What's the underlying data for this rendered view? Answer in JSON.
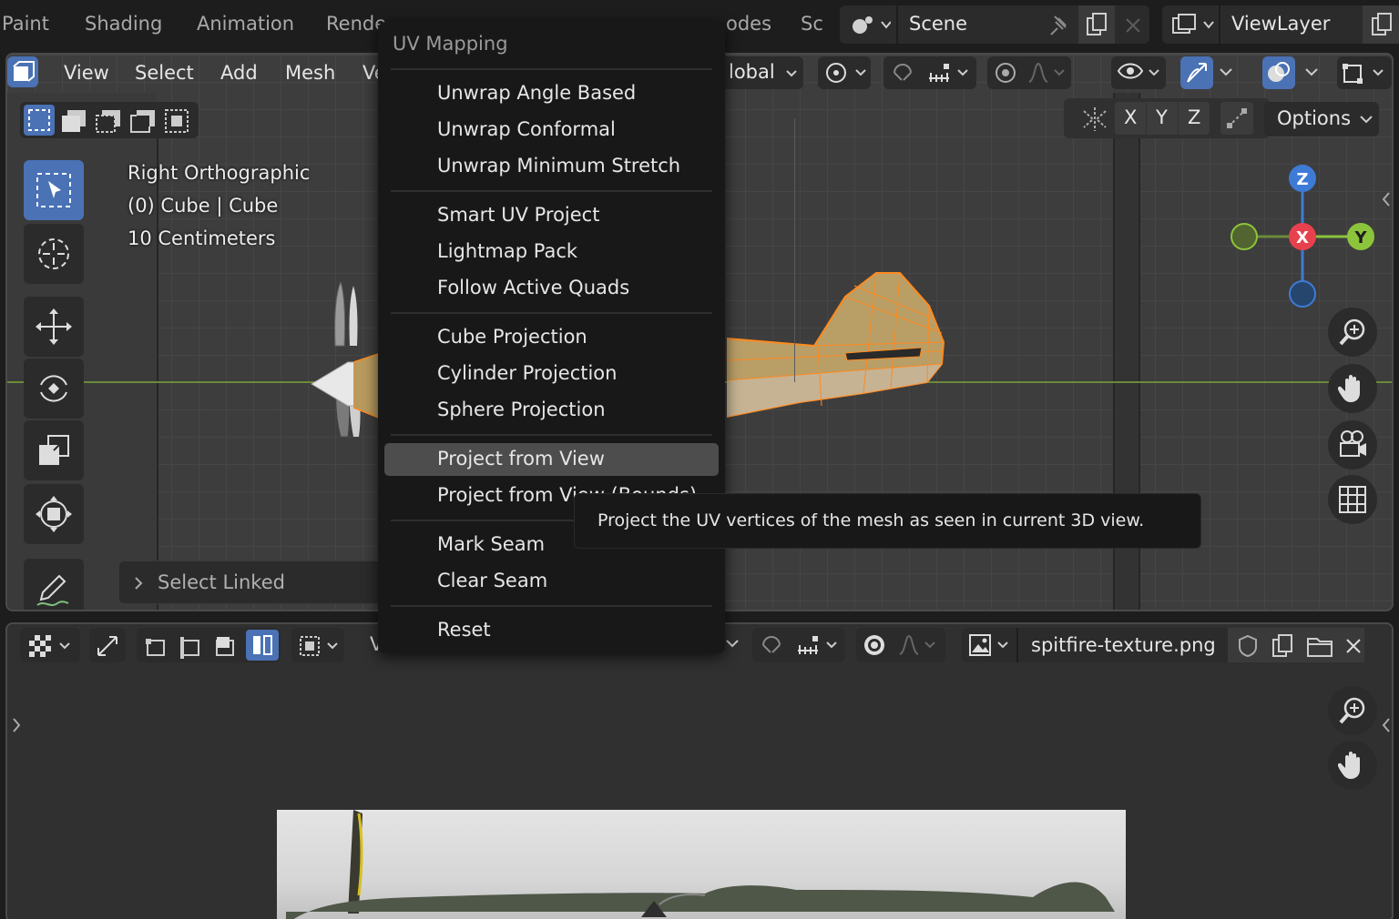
{
  "topbar": {
    "tabs": [
      "Paint",
      "Shading",
      "Animation",
      "Rende",
      "odes",
      "Sc"
    ],
    "scene_label": "Scene",
    "viewlayer_label": "ViewLayer"
  },
  "viewport": {
    "menus": [
      "View",
      "Select",
      "Add",
      "Mesh",
      "Ve"
    ],
    "orientation_label": "lobal",
    "axis_buttons": [
      "X",
      "Y",
      "Z"
    ],
    "options_label": "Options",
    "overlay": {
      "view_name": "Right Orthographic",
      "object_info": "(0) Cube | Cube",
      "scale_info": "10 Centimeters"
    },
    "gizmo": {
      "z": "Z",
      "x": "X",
      "y": "Y"
    },
    "last_op_label": "Select Linked",
    "colors": {
      "accent": "#4a72b5",
      "mesh_edge": "#ff8a1f",
      "gizmo_x": "#e8414e",
      "gizmo_y": "#8cc43b",
      "gizmo_z": "#3e7bd6"
    }
  },
  "uv_menu": {
    "title": "UV Mapping",
    "groups": [
      [
        "Unwrap Angle Based",
        "Unwrap Conformal",
        "Unwrap Minimum Stretch"
      ],
      [
        "Smart UV Project",
        "Lightmap Pack",
        "Follow Active Quads"
      ],
      [
        "Cube Projection",
        "Cylinder Projection",
        "Sphere Projection"
      ],
      [
        "Project from View",
        "Project from View (Bounds)"
      ],
      [
        "Mark Seam",
        "Clear Seam"
      ],
      [
        "Reset"
      ]
    ],
    "highlighted": "Project from View"
  },
  "tooltip": {
    "text": "Project the UV vertices of the mesh as seen in current 3D view."
  },
  "uv_editor": {
    "menu_partial": "V",
    "image_name": "spitfire-texture.png"
  }
}
